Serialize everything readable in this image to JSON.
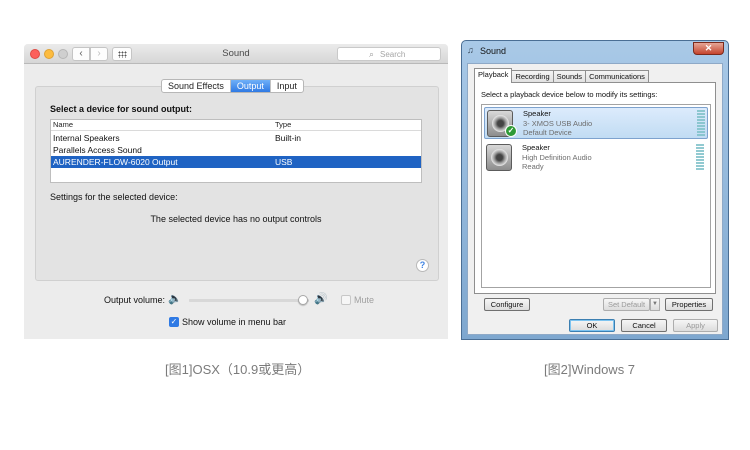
{
  "osx": {
    "window_title": "Sound",
    "search_placeholder": "Search",
    "tabs": [
      "Sound Effects",
      "Output",
      "Input"
    ],
    "active_tab": "Output",
    "select_label": "Select a device for sound output:",
    "table": {
      "headers": [
        "Name",
        "Type"
      ],
      "rows": [
        {
          "name": "Internal Speakers",
          "type": "Built-in"
        },
        {
          "name": "Parallels Access Sound",
          "type": ""
        },
        {
          "name": "AURENDER-FLOW-6020 Output",
          "type": "USB"
        }
      ],
      "selected_index": 2
    },
    "settings_label": "Settings for the selected device:",
    "no_controls_text": "The selected device has no output controls",
    "help_glyph": "?",
    "volume_label": "Output volume:",
    "volume_level": 0.95,
    "mute_label": "Mute",
    "mute_checked": false,
    "menu_bar_label": "Show volume in menu bar",
    "menu_bar_checked": true
  },
  "win7": {
    "window_title": "Sound",
    "close_glyph": "✕",
    "tabs": [
      "Playback",
      "Recording",
      "Sounds",
      "Communications"
    ],
    "active_tab": "Playback",
    "hint": "Select a playback device below to modify its settings:",
    "devices": [
      {
        "name": "Speaker",
        "line2": "3- XMOS USB Audio",
        "line3": "Default Device",
        "selected": true,
        "default": true
      },
      {
        "name": "Speaker",
        "line2": "High Definition Audio",
        "line3": "Ready",
        "selected": false,
        "default": false
      }
    ],
    "buttons": {
      "configure": "Configure",
      "set_default": "Set Default",
      "properties": "Properties",
      "ok": "OK",
      "cancel": "Cancel",
      "apply": "Apply"
    }
  },
  "captions": {
    "left": "[图1]OSX（10.9或更高）",
    "right": "[图2]Windows 7"
  }
}
